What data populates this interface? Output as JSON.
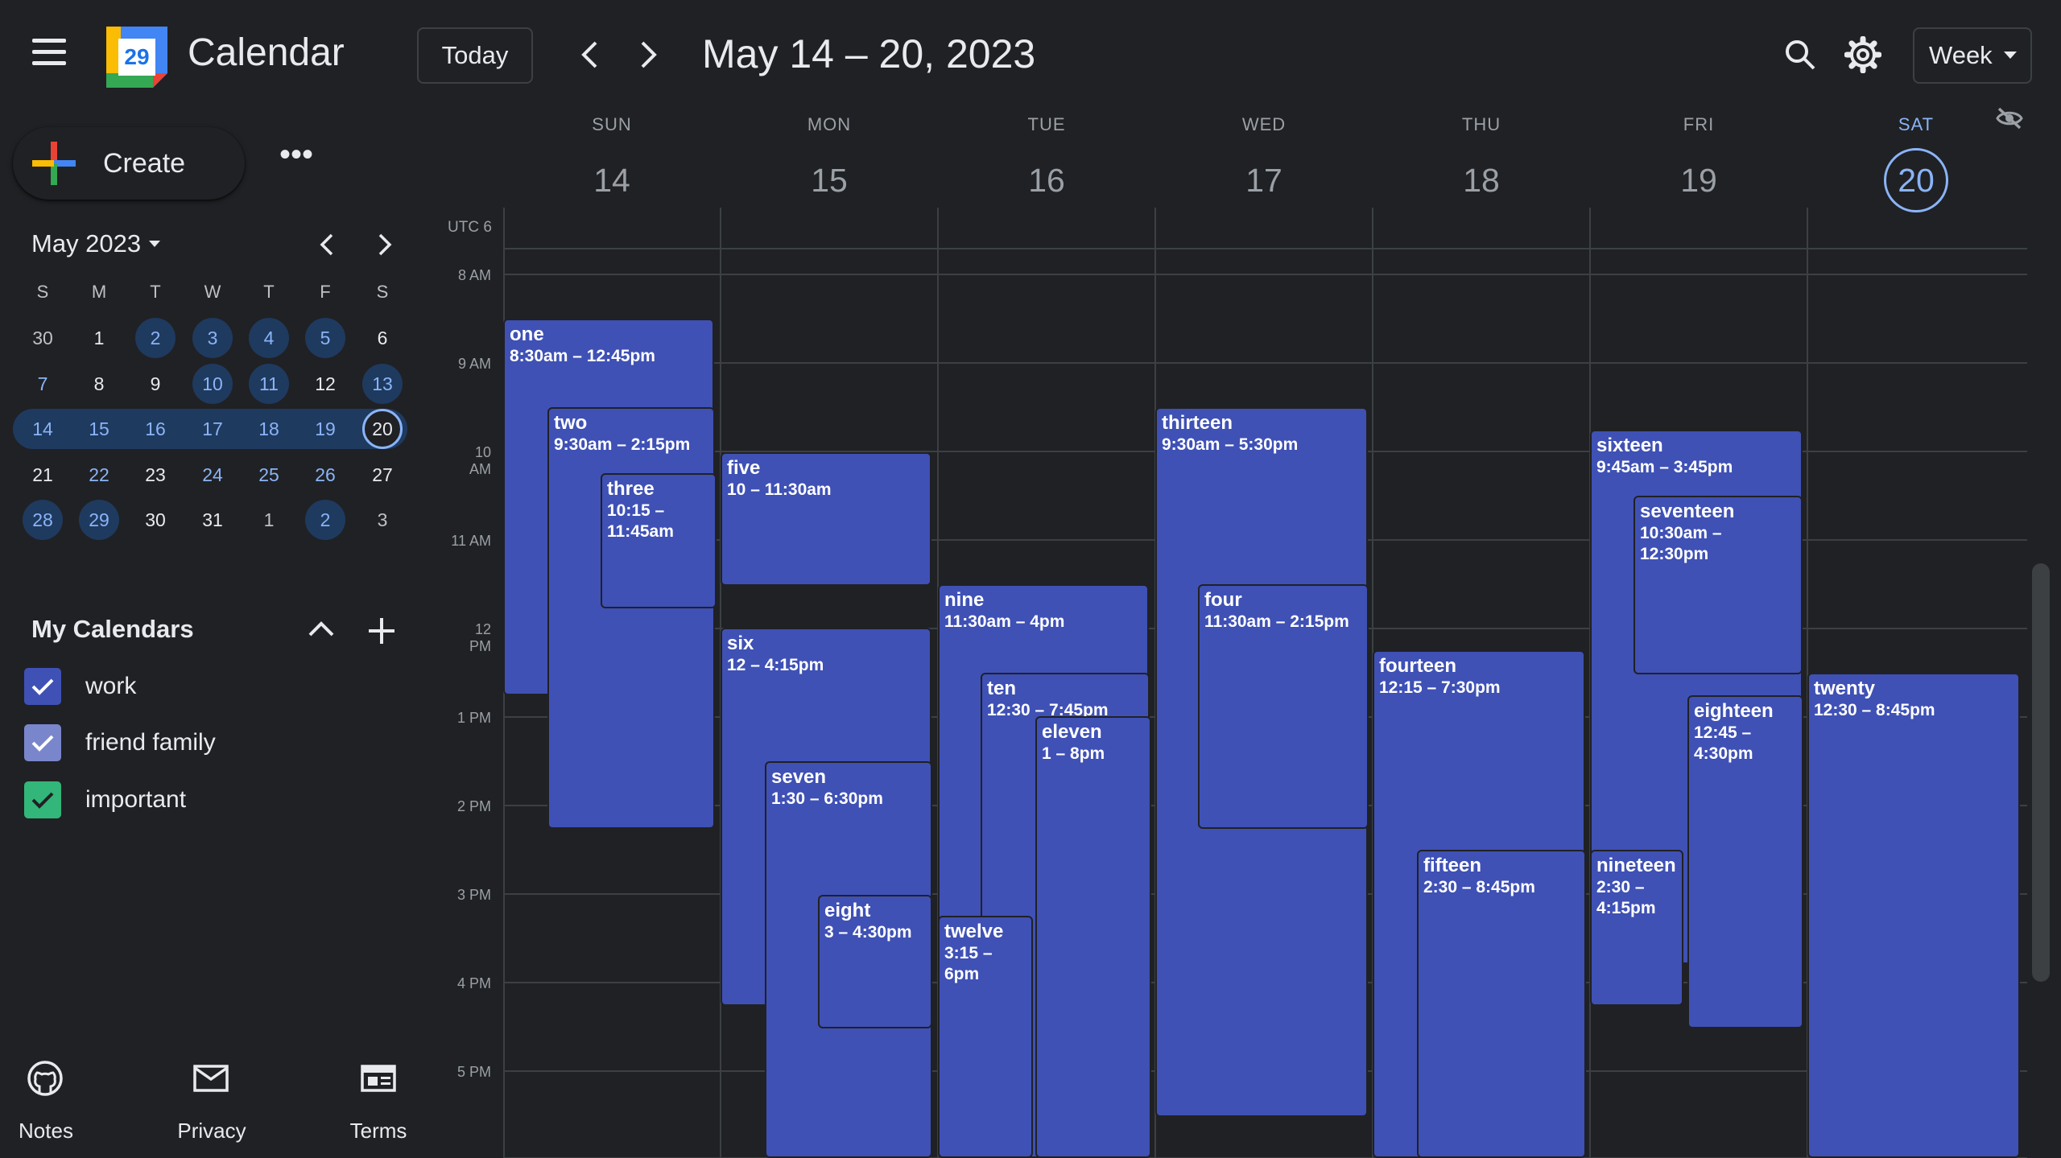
{
  "header": {
    "app_title": "Calendar",
    "logo_day": "29",
    "today_label": "Today",
    "date_range": "May 14 – 20, 2023",
    "view_label": "Week"
  },
  "sidebar": {
    "create_label": "Create",
    "more_label": "•••",
    "mini_calendar": {
      "month_label": "May 2023",
      "dow": [
        "S",
        "M",
        "T",
        "W",
        "T",
        "F",
        "S"
      ],
      "weeks": [
        [
          "30",
          "1",
          "2",
          "3",
          "4",
          "5",
          "6"
        ],
        [
          "7",
          "8",
          "9",
          "10",
          "11",
          "12",
          "13"
        ],
        [
          "14",
          "15",
          "16",
          "17",
          "18",
          "19",
          "20"
        ],
        [
          "21",
          "22",
          "23",
          "24",
          "25",
          "26",
          "27"
        ],
        [
          "28",
          "29",
          "30",
          "31",
          "1",
          "2",
          "3"
        ]
      ]
    },
    "my_calendars_title": "My Calendars",
    "calendars": [
      {
        "label": "work",
        "color": "#3f51b5"
      },
      {
        "label": "friend family",
        "color": "#7986cb"
      },
      {
        "label": "important",
        "color": "#33b679"
      }
    ]
  },
  "footer": {
    "notes_label": "Notes",
    "privacy_label": "Privacy",
    "terms_label": "Terms"
  },
  "week": {
    "tz_label": "UTC 6",
    "days": [
      {
        "dow": "SUN",
        "num": "14"
      },
      {
        "dow": "MON",
        "num": "15"
      },
      {
        "dow": "TUE",
        "num": "16"
      },
      {
        "dow": "WED",
        "num": "17"
      },
      {
        "dow": "THU",
        "num": "18"
      },
      {
        "dow": "FRI",
        "num": "19"
      },
      {
        "dow": "SAT",
        "num": "20"
      }
    ],
    "hours": [
      "8 AM",
      "9 AM",
      "10 AM",
      "11 AM",
      "12 PM",
      "1 PM",
      "2 PM",
      "3 PM",
      "4 PM",
      "5 PM"
    ]
  },
  "events": [
    {
      "title": "one",
      "time": "8:30am – 12:45pm"
    },
    {
      "title": "two",
      "time": "9:30am – 2:15pm"
    },
    {
      "title": "three",
      "time": "10:15 – 11:45am"
    },
    {
      "title": "five",
      "time": "10 – 11:30am"
    },
    {
      "title": "six",
      "time": "12 – 4:15pm"
    },
    {
      "title": "seven",
      "time": "1:30 – 6:30pm"
    },
    {
      "title": "eight",
      "time": "3 – 4:30pm"
    },
    {
      "title": "nine",
      "time": "11:30am – 4pm"
    },
    {
      "title": "ten",
      "time": "12:30 – 7:45pm"
    },
    {
      "title": "eleven",
      "time": "1 – 8pm"
    },
    {
      "title": "twelve",
      "time": "3:15 – 6pm"
    },
    {
      "title": "thirteen",
      "time": "9:30am – 5:30pm"
    },
    {
      "title": "four",
      "time": "11:30am – 2:15pm"
    },
    {
      "title": "fourteen",
      "time": "12:15 – 7:30pm"
    },
    {
      "title": "fifteen",
      "time": "2:30 – 8:45pm"
    },
    {
      "title": "sixteen",
      "time": "9:45am – 3:45pm"
    },
    {
      "title": "seventeen",
      "time": "10:30am – 12:30pm"
    },
    {
      "title": "eighteen",
      "time": "12:45 – 4:30pm"
    },
    {
      "title": "nineteen",
      "time": "2:30 – 4:15pm"
    },
    {
      "title": "twenty",
      "time": "12:30 – 8:45pm"
    }
  ],
  "colors": {
    "event": "#3f51b5",
    "accent": "#8ab4f8",
    "background": "#202124"
  }
}
